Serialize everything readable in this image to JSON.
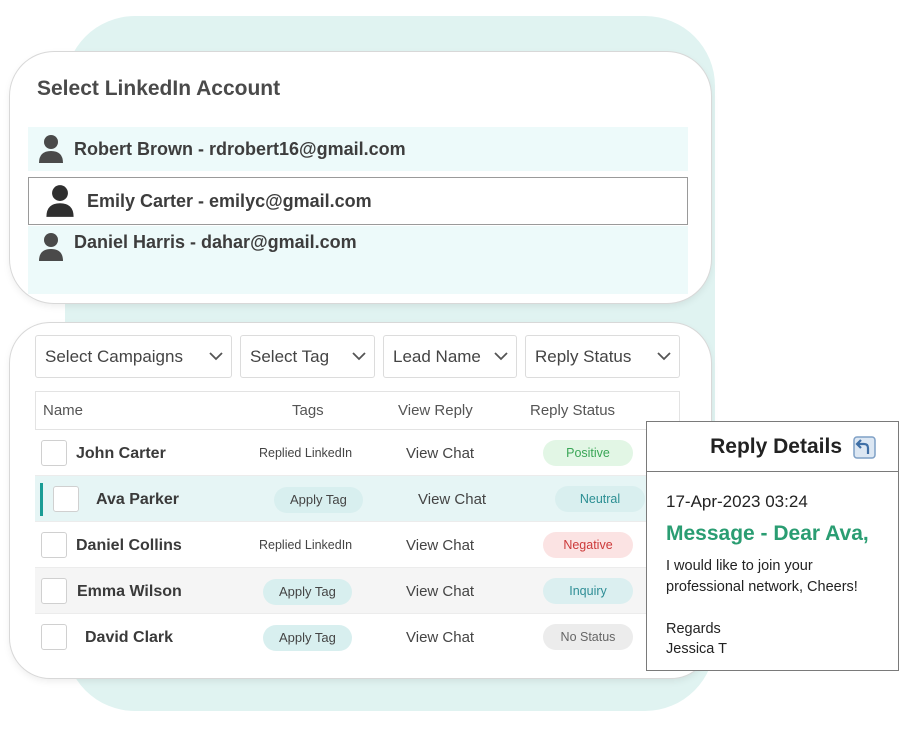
{
  "account_selector": {
    "title": "Select LinkedIn Account",
    "accounts": [
      {
        "label": "Robert Brown - rdrobert16@gmail.com",
        "icon": "user-icon"
      },
      {
        "label": "Emily Carter - emilyc@gmail.com",
        "icon": "user-icon",
        "selected": true
      },
      {
        "label": "Daniel Harris - dahar@gmail.com",
        "icon": "user-icon"
      }
    ]
  },
  "filters": {
    "campaigns": "Select Campaigns",
    "tag": "Select Tag",
    "lead_name": "Lead Name",
    "reply_status": "Reply Status"
  },
  "table": {
    "headers": {
      "name": "Name",
      "tags": "Tags",
      "view_reply": "View Reply",
      "reply_status": "Reply Status"
    },
    "rows": [
      {
        "name": "John Carter",
        "tag": "Replied LinkedIn",
        "view": "View Chat",
        "status": "Positive"
      },
      {
        "name": "Ava Parker",
        "tag": "Apply Tag",
        "view": "View Chat",
        "status": "Neutral"
      },
      {
        "name": "Daniel Collins",
        "tag": "Replied LinkedIn",
        "view": "View Chat",
        "status": "Negative"
      },
      {
        "name": "Emma Wilson",
        "tag": "Apply Tag",
        "view": "View Chat",
        "status": "Inquiry"
      },
      {
        "name": "David Clark",
        "tag": "Apply Tag",
        "view": "View Chat",
        "status": "No Status"
      }
    ]
  },
  "reply_details": {
    "title": "Reply Details",
    "icon": "reply-icon",
    "datetime": "17-Apr-2023  03:24",
    "subject": "Message - Dear Ava,",
    "body": "I would like to join your professional network, Cheers!",
    "regards": "Regards",
    "signature": "Jessica T"
  },
  "colors": {
    "accent_teal": "#1a9c95",
    "message_green": "#2a9d72",
    "background_tint": "#e0f3f1"
  }
}
